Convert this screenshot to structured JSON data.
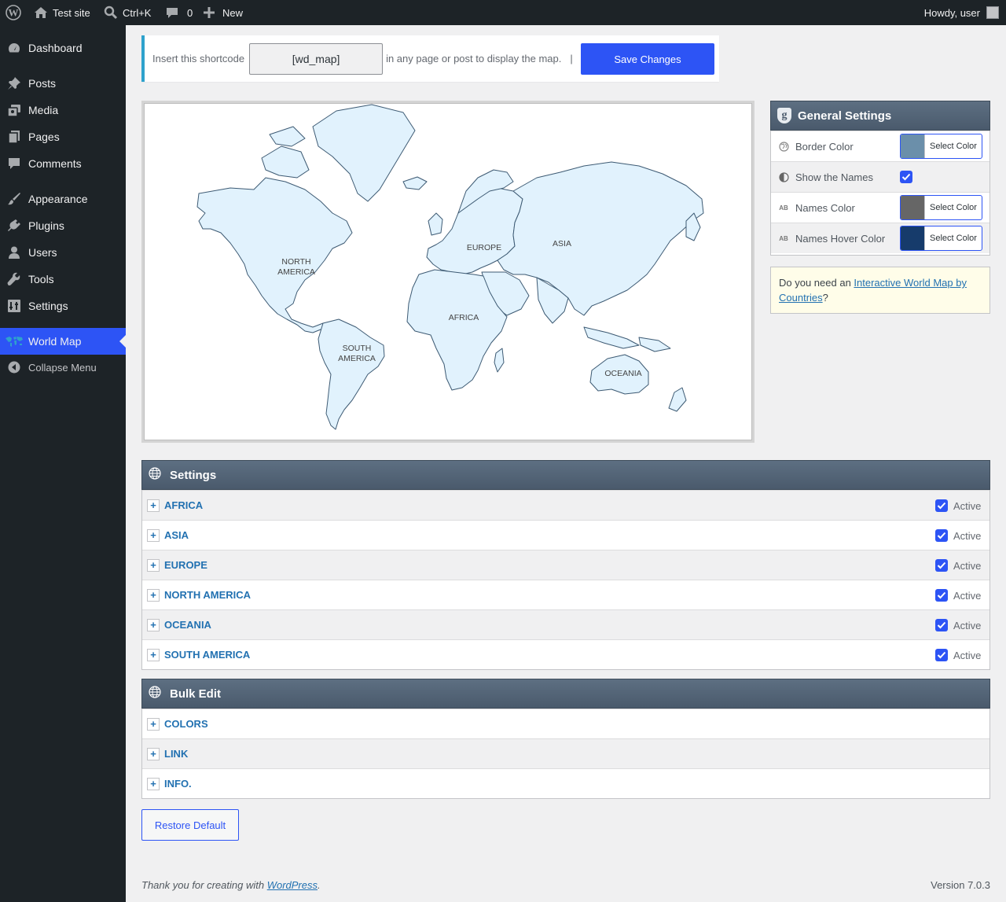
{
  "admin_bar": {
    "site_name": "Test site",
    "search_shortcut": "Ctrl+K",
    "comments_count": "0",
    "new_label": "New",
    "greeting": "Howdy, user"
  },
  "sidebar": {
    "items": [
      {
        "label": "Dashboard",
        "icon": "dashboard-icon"
      },
      {
        "label": "Posts",
        "icon": "pin-icon"
      },
      {
        "label": "Media",
        "icon": "media-icon"
      },
      {
        "label": "Pages",
        "icon": "pages-icon"
      },
      {
        "label": "Comments",
        "icon": "comment-icon"
      },
      {
        "label": "Appearance",
        "icon": "brush-icon"
      },
      {
        "label": "Plugins",
        "icon": "plug-icon"
      },
      {
        "label": "Users",
        "icon": "user-icon"
      },
      {
        "label": "Tools",
        "icon": "wrench-icon"
      },
      {
        "label": "Settings",
        "icon": "sliders-icon"
      },
      {
        "label": "World Map",
        "icon": "world-map-icon"
      }
    ],
    "collapse_label": "Collapse Menu",
    "current": "World Map"
  },
  "shortcode": {
    "prefix": "Insert this shortcode",
    "value": "[wd_map]",
    "suffix": "in any page or post to display the map.",
    "separator": "|",
    "save_label": "Save Changes"
  },
  "map": {
    "labels": {
      "north_america_1": "NORTH",
      "north_america_2": "AMERICA",
      "south_america_1": "SOUTH",
      "south_america_2": "AMERICA",
      "europe": "EUROPE",
      "asia": "ASIA",
      "africa": "AFRICA",
      "oceania": "OCEANIA"
    },
    "fill_color": "#e1f2fd",
    "border_color": "#3d5a73"
  },
  "general_settings": {
    "title": "General Settings",
    "rows": {
      "border_color": {
        "label": "Border Color",
        "button": "Select Color",
        "color": "#6b8faa"
      },
      "show_names": {
        "label": "Show the Names",
        "checked": true
      },
      "names_color": {
        "label": "Names Color",
        "button": "Select Color",
        "color": "#666666"
      },
      "names_hover_color": {
        "label": "Names Hover Color",
        "button": "Select Color",
        "color": "#163b6b"
      }
    }
  },
  "promo": {
    "prefix": "Do you need an ",
    "link_text": "Interactive World Map by Countries",
    "suffix": "?"
  },
  "settings_panel": {
    "title": "Settings",
    "rows": [
      {
        "name": "AFRICA",
        "status": "Active"
      },
      {
        "name": "ASIA",
        "status": "Active"
      },
      {
        "name": "EUROPE",
        "status": "Active"
      },
      {
        "name": "NORTH AMERICA",
        "status": "Active"
      },
      {
        "name": "OCEANIA",
        "status": "Active"
      },
      {
        "name": "SOUTH AMERICA",
        "status": "Active"
      }
    ]
  },
  "bulk_panel": {
    "title": "Bulk Edit",
    "rows": [
      {
        "name": "COLORS"
      },
      {
        "name": "LINK"
      },
      {
        "name": "INFO."
      }
    ]
  },
  "restore_label": "Restore Default",
  "footer": {
    "thanks_prefix": "Thank you for creating with ",
    "thanks_link": "WordPress",
    "thanks_suffix": ".",
    "version": "Version 7.0.3"
  },
  "colors": {
    "accent": "#2d54f5",
    "admin_dark": "#1d2327",
    "link": "#2271b1"
  }
}
